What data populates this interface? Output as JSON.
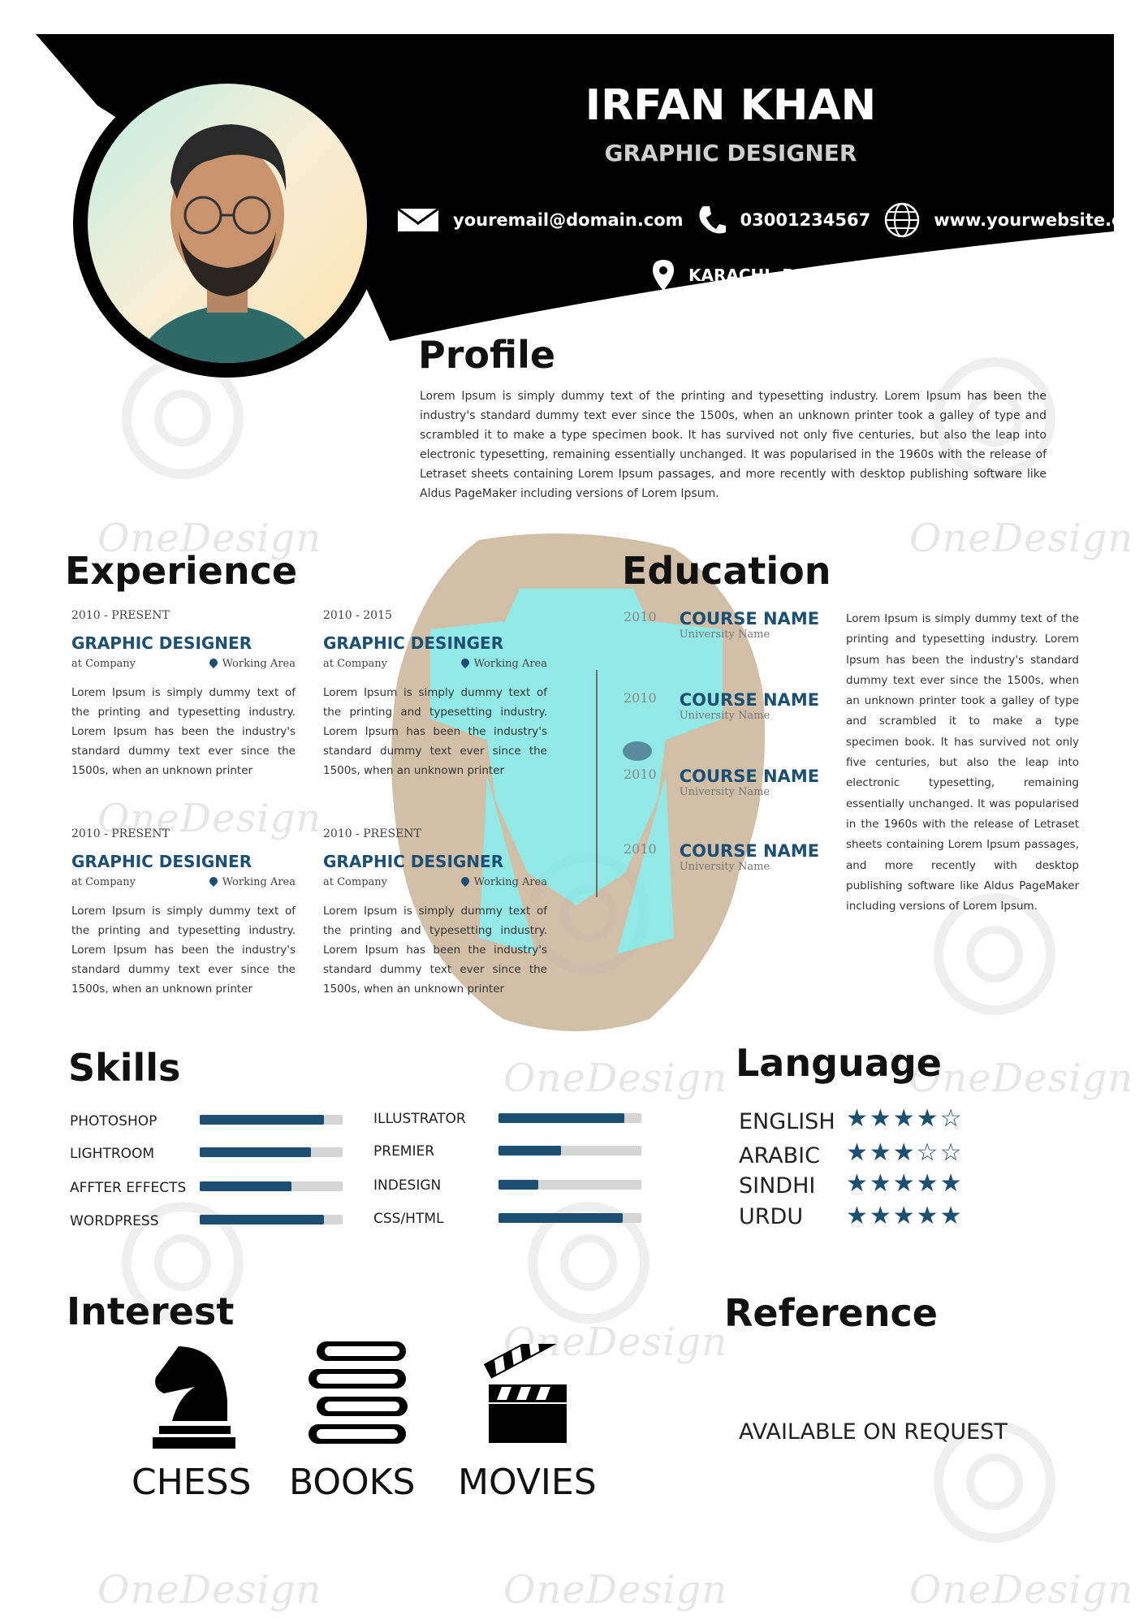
{
  "colors": {
    "accent": "#1d4f73",
    "header_bg": "#000000",
    "text": "#1a1a1a"
  },
  "header": {
    "name": "IRFAN KHAN",
    "role": "GRAPHIC DESIGNER",
    "email": "youremail@domain.com",
    "phone": "03001234567",
    "website": "www.yourwebsite.com",
    "location": "KARACHI, PAKISTAN"
  },
  "watermark": "OneDesign",
  "profile": {
    "title": "Profile",
    "text": "Lorem Ipsum is simply dummy text of the printing and typesetting industry. Lorem Ipsum has been the industry's standard dummy text ever since the 1500s, when an unknown printer took a galley of type and scrambled it to make a type specimen book. It has survived not only five centuries, but also the leap into electronic typesetting, remaining essentially unchanged. It was popularised in the 1960s with the release of Letraset sheets containing Lorem Ipsum passages, and more recently with desktop publishing software like Aldus PageMaker including versions of Lorem Ipsum."
  },
  "experience": {
    "title": "Experience",
    "jobs": [
      {
        "date": "2010 - PRESENT",
        "title": "GRAPHIC DESIGNER",
        "company": "at Company",
        "area": "Working Area",
        "desc": "Lorem Ipsum is simply dummy text of the printing and typesetting industry. Lorem Ipsum has been the industry's standard dummy text ever since the 1500s, when an unknown printer"
      },
      {
        "date": "2010 - 2015",
        "title": "GRAPHIC DESINGER",
        "company": "at Company",
        "area": "Working Area",
        "desc": "Lorem Ipsum is simply dummy text of the printing and typesetting industry. Lorem Ipsum has been the industry's standard dummy text ever since the 1500s, when an unknown printer"
      },
      {
        "date": "2010 - PRESENT",
        "title": "GRAPHIC DESIGNER",
        "company": "at Company",
        "area": "Working Area",
        "desc": "Lorem Ipsum is simply dummy text of the printing and typesetting industry. Lorem Ipsum has been the industry's standard dummy text ever since the 1500s, when an unknown printer"
      },
      {
        "date": "2010 - PRESENT",
        "title": "GRAPHIC DESIGNER",
        "company": "at Company",
        "area": "Working Area",
        "desc": "Lorem Ipsum is simply dummy text of the printing and typesetting industry. Lorem Ipsum has been the industry's standard dummy text ever since the 1500s, when an unknown printer"
      }
    ]
  },
  "education": {
    "title": "Education",
    "items": [
      {
        "year": "2010",
        "course": "COURSE NAME",
        "university": "University Name"
      },
      {
        "year": "2010",
        "course": "COURSE NAME",
        "university": "University Name"
      },
      {
        "year": "2010",
        "course": "COURSE NAME",
        "university": "University Name"
      },
      {
        "year": "2010",
        "course": "COURSE NAME",
        "university": "University Name"
      }
    ],
    "text": "Lorem Ipsum is simply dummy text of the printing and typesetting industry. Lorem Ipsum has been the industry's standard dummy text ever since the 1500s, when an unknown printer took a galley of type and scrambled it to make a type specimen book. It has survived not only five centuries, but also the leap into electronic typesetting, remaining essentially unchanged. It was popularised in the 1960s with the release of Letraset sheets containing Lorem Ipsum passages, and more recently with desktop publishing software like Aldus PageMaker including versions of Lorem Ipsum."
  },
  "skills": {
    "title": "Skills",
    "items": [
      {
        "label": "PHOTOSHOP",
        "level": 0.87
      },
      {
        "label": "LIGHTROOM",
        "level": 0.78
      },
      {
        "label": "AFFTER EFFECTS",
        "level": 0.64
      },
      {
        "label": "WORDPRESS",
        "level": 0.87
      },
      {
        "label": "ILLUSTRATOR",
        "level": 0.88
      },
      {
        "label": "PREMIER",
        "level": 0.44
      },
      {
        "label": "INDESIGN",
        "level": 0.28
      },
      {
        "label": "CSS/HTML",
        "level": 0.87
      }
    ]
  },
  "language": {
    "title": "Language",
    "items": [
      {
        "label": "ENGLISH",
        "stars": "★★★★☆",
        "rating": 4
      },
      {
        "label": "ARABIC",
        "stars": "★★★☆☆",
        "rating": 3
      },
      {
        "label": "SINDHI",
        "stars": "★★★★★",
        "rating": 5
      },
      {
        "label": "URDU",
        "stars": "★★★★★",
        "rating": 5
      }
    ]
  },
  "interest": {
    "title": "Interest",
    "items": [
      {
        "label": "CHESS",
        "icon": "chess-knight-icon"
      },
      {
        "label": "BOOKS",
        "icon": "books-icon"
      },
      {
        "label": "MOVIES",
        "icon": "clapperboard-icon"
      }
    ]
  },
  "reference": {
    "title": "Reference",
    "text": "AVAILABLE ON REQUEST"
  }
}
